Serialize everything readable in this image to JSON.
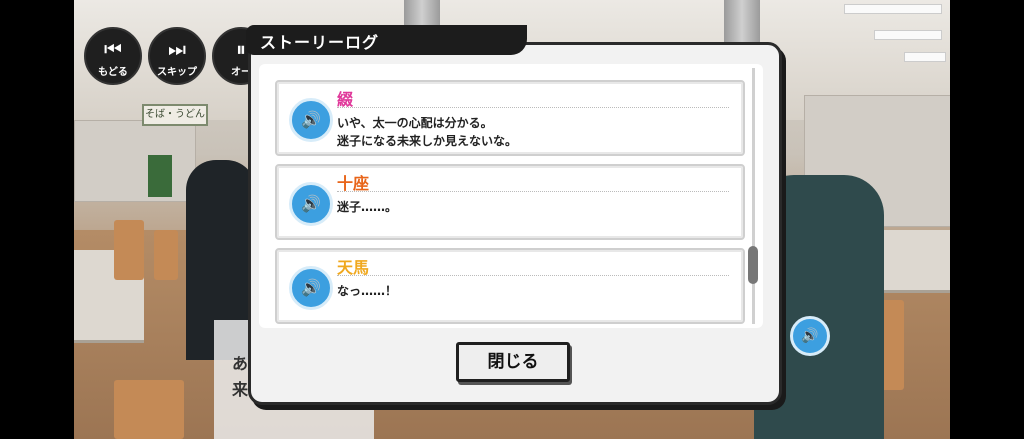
{
  "controls": {
    "back_label": "もどる",
    "skip_label": "スキップ",
    "auto_label": "オー"
  },
  "background": {
    "sign_text": "そば・うどん"
  },
  "dialog": {
    "title": "ストーリーログ",
    "close_label": "閉じる",
    "entries": [
      {
        "speaker": "綴",
        "speaker_color": "#e0389a",
        "lines": [
          "いや、太一の心配は分かる。",
          "迷子になる未来しか見えないな。"
        ]
      },
      {
        "speaker": "十座",
        "speaker_color": "#e8651a",
        "lines": [
          "迷子……。"
        ]
      },
      {
        "speaker": "天馬",
        "speaker_color": "#f0a81e",
        "lines": [
          "なっ……！"
        ]
      }
    ]
  },
  "behind_text": {
    "line1": "あ",
    "line2": "来"
  },
  "icons": {
    "back": "rewind-icon",
    "skip": "skip-icon",
    "auto": "auto-icon",
    "voice": "speaker-icon"
  }
}
